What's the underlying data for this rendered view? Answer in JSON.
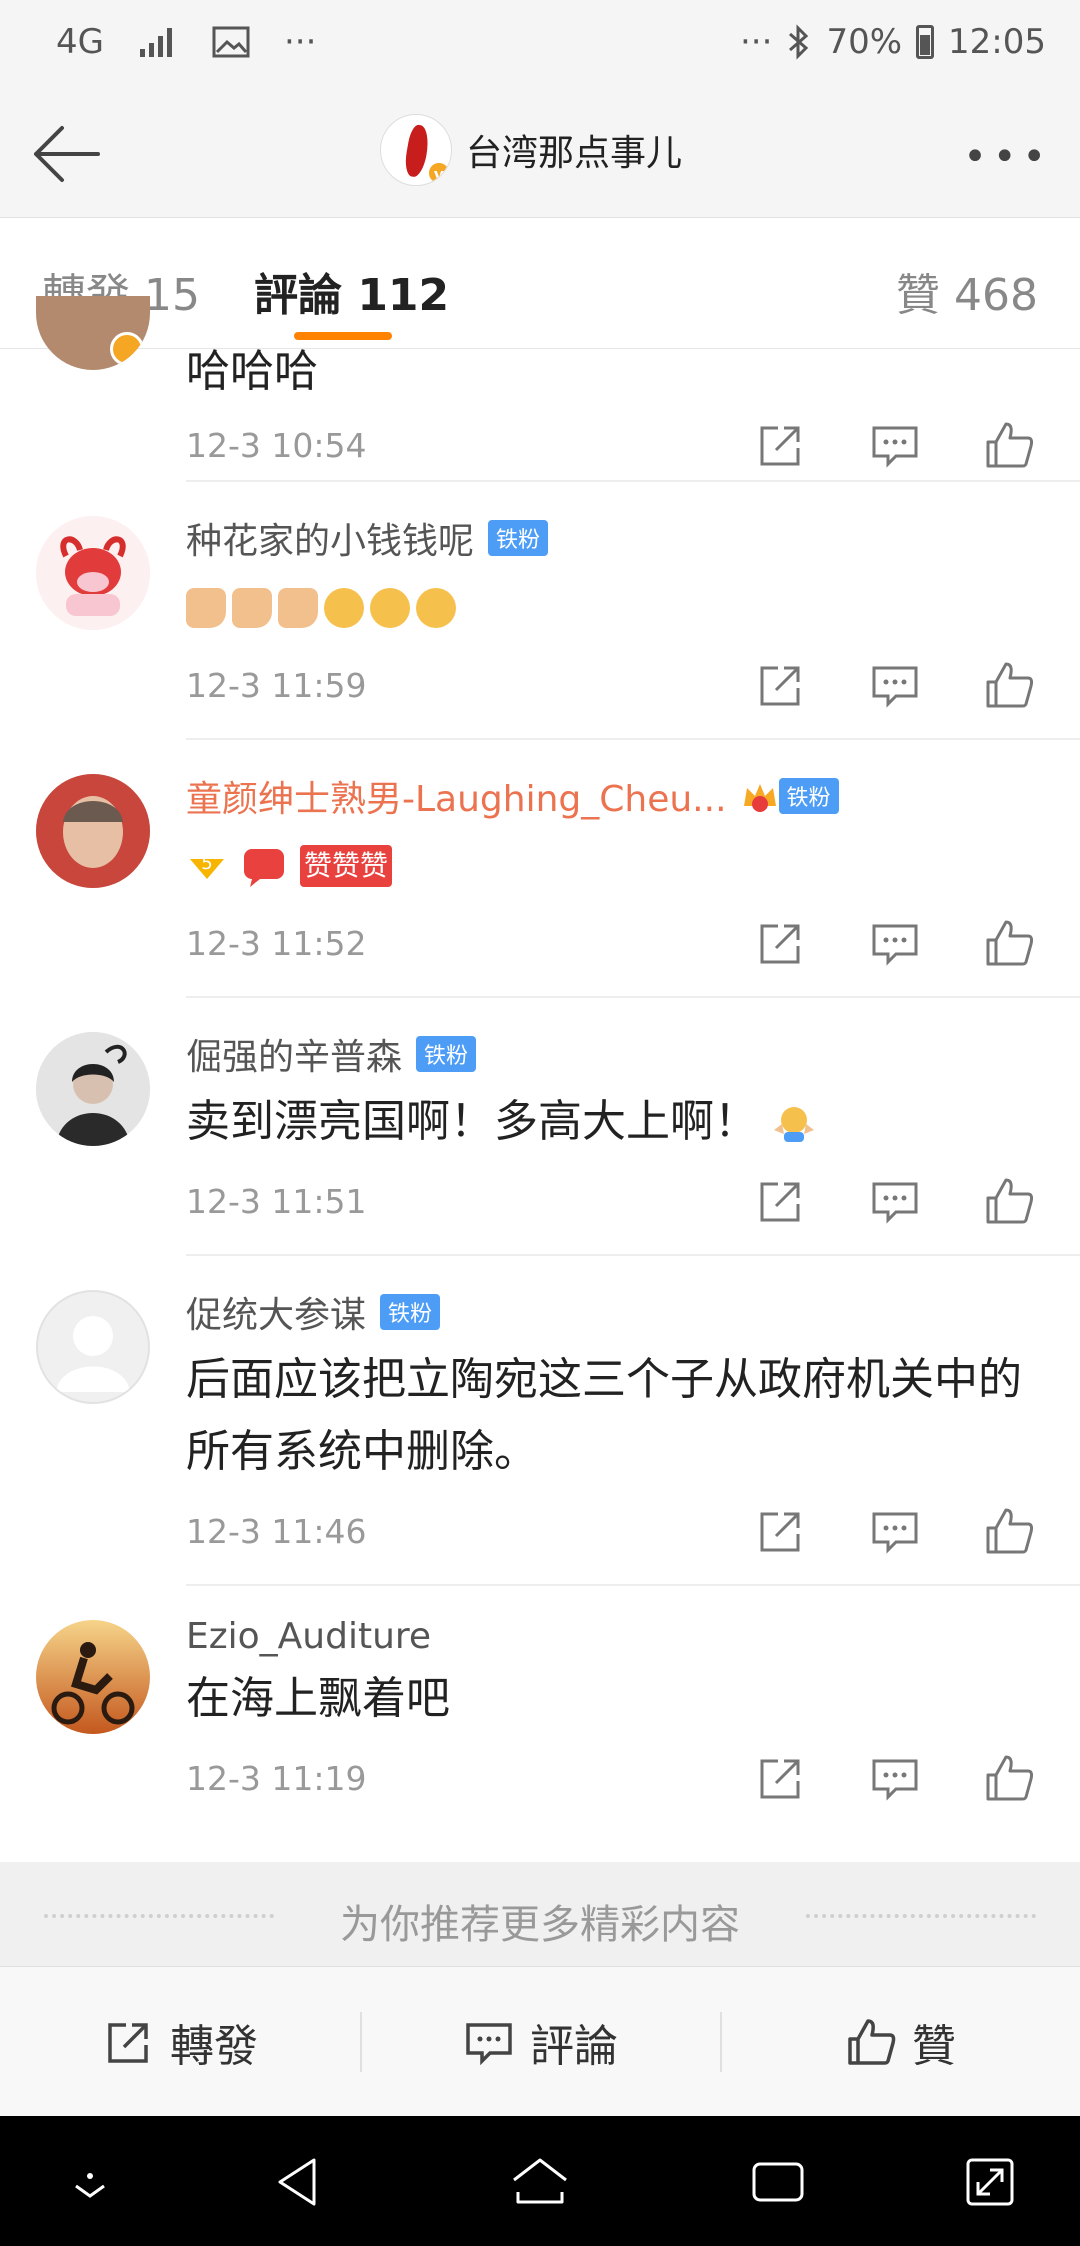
{
  "status_bar": {
    "network": "4G",
    "dots_left": "···",
    "dots_right": "···",
    "battery": "70%",
    "time": "12:05"
  },
  "header": {
    "account_name": "台湾那点事儿",
    "verified_mark": "v",
    "more": "•••"
  },
  "tabs": {
    "repost": "轉發 15",
    "comments": "評論 112",
    "likes": "贊 468"
  },
  "comments": [
    {
      "content": "哈哈哈",
      "time": "12-3 10:54"
    },
    {
      "username": "种花家的小钱钱呢",
      "badge": "铁粉",
      "time": "12-3 11:59"
    },
    {
      "username": "童颜绅士熟男-Laughing_Cheu...",
      "badge": "铁粉",
      "sticker_text": "赞赞赞",
      "time": "12-3 11:52"
    },
    {
      "username": "倔强的辛普森",
      "badge": "铁粉",
      "content": "卖到漂亮国啊！多高大上啊！",
      "time": "12-3 11:51"
    },
    {
      "username": "促统大参谋",
      "badge": "铁粉",
      "content": "后面应该把立陶宛这三个子从政府机关中的所有系统中删除。",
      "time": "12-3 11:46"
    },
    {
      "username": "Ezio_Auditure",
      "content": "在海上飘着吧",
      "time": "12-3 11:19"
    }
  ],
  "recommend": "为你推荐更多精彩内容",
  "bottom_bar": {
    "repost": "轉發",
    "comment": "評論",
    "like": "贊"
  },
  "colors": {
    "accent": "#ff8200",
    "badge": "#4d9df6",
    "vip_name": "#eb7350"
  }
}
